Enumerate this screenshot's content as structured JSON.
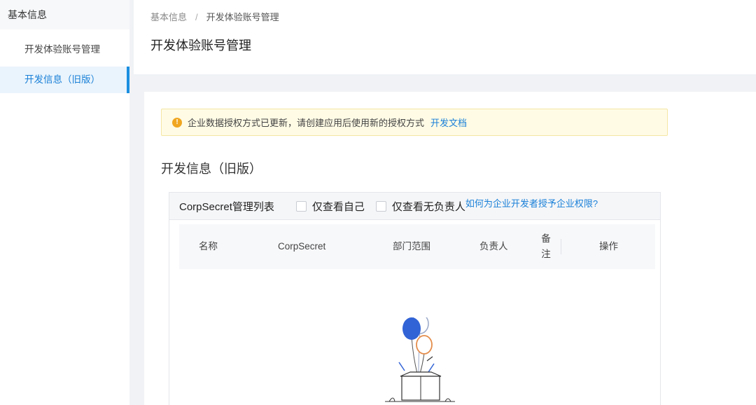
{
  "sidebar": {
    "section_title": "基本信息",
    "items": [
      {
        "label": "开发体验账号管理",
        "active": false
      },
      {
        "label": "开发信息（旧版）",
        "active": true
      }
    ]
  },
  "header": {
    "breadcrumb": [
      "基本信息",
      "/",
      "开发体验账号管理"
    ],
    "title": "开发体验账号管理"
  },
  "notice": {
    "icon": "warning-icon",
    "text": "企业数据授权方式已更新，请创建应用后使用新的授权方式",
    "link_label": "开发文档"
  },
  "section": {
    "heading": "开发信息（旧版）"
  },
  "table": {
    "title": "CorpSecret管理列表",
    "filters": [
      {
        "label": "仅查看自己",
        "checked": false
      },
      {
        "label": "仅查看无负责人",
        "checked": false
      }
    ],
    "help_link": "如何为企业开发者授予企业权限?",
    "columns": [
      "名称",
      "CorpSecret",
      "部门范围",
      "负责人",
      "备注",
      "操作"
    ],
    "rows": [],
    "empty_icon": "empty-box-balloons-icon"
  },
  "colors": {
    "accent": "#1a80d8",
    "warning": "#f0a620",
    "notice_bg": "#fffbe5",
    "sidebar_active_bg": "#eaf4fc"
  }
}
